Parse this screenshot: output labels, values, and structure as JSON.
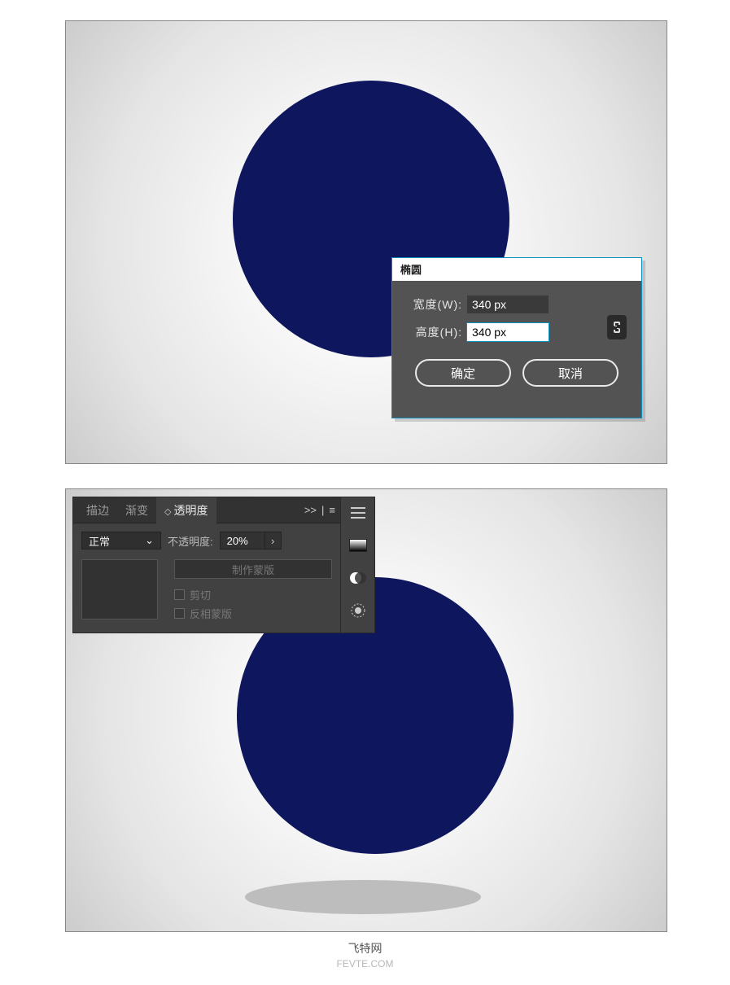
{
  "dialog": {
    "title": "椭圆",
    "width_label": "宽度(W):",
    "height_label": "高度(H):",
    "width_value": "340 px",
    "height_value": "340 px",
    "ok": "确定",
    "cancel": "取消"
  },
  "panel": {
    "tabs": {
      "stroke": "描边",
      "gradient": "渐变",
      "transparency": "透明度"
    },
    "chevrons": ">>",
    "blend_mode": "正常",
    "opacity_label": "不透明度:",
    "opacity_value": "20%",
    "make_mask": "制作蒙版",
    "clip": "剪切",
    "invert_mask": "反相蒙版"
  },
  "watermark": {
    "line1": "飞特网",
    "line2": "FEVTE.COM"
  }
}
